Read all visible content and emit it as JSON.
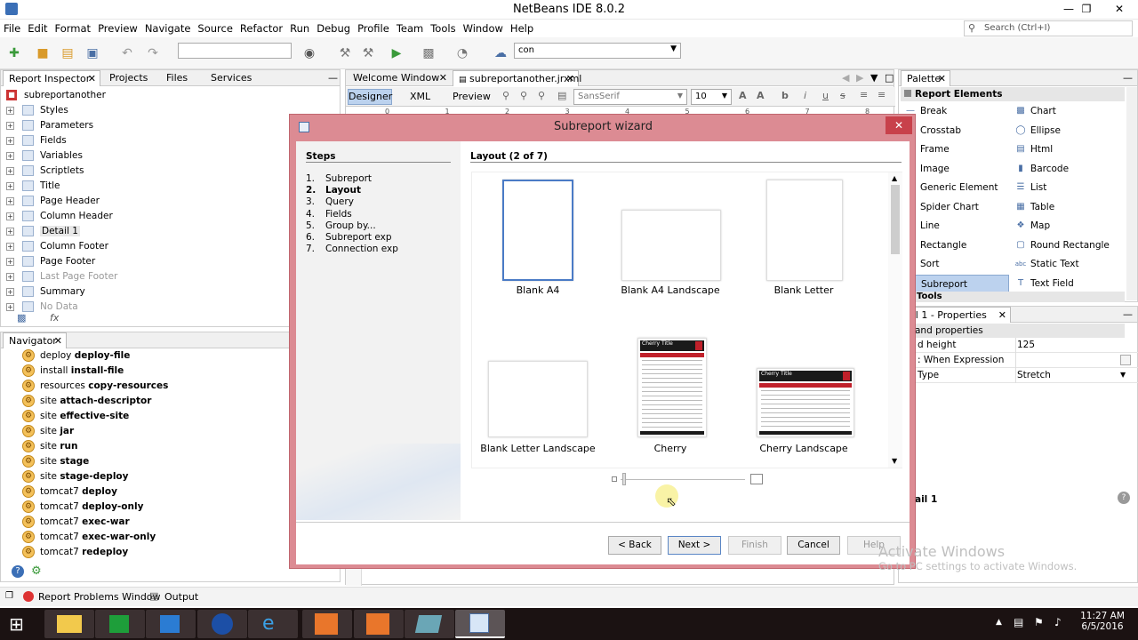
{
  "window": {
    "title": "NetBeans IDE 8.0.2"
  },
  "menu": [
    "File",
    "Edit",
    "Format",
    "Preview",
    "Navigate",
    "Source",
    "Refactor",
    "Run",
    "Debug",
    "Profile",
    "Team",
    "Tools",
    "Window",
    "Help"
  ],
  "search": {
    "placeholder": "Search (Ctrl+I)"
  },
  "toolbar": {
    "config_combo": "con"
  },
  "left_tabs": [
    "Report Inspector",
    "Projects",
    "Files",
    "Services"
  ],
  "report_tree": {
    "root": "subreportanother",
    "items": [
      {
        "label": "Styles",
        "greyed": false
      },
      {
        "label": "Parameters",
        "greyed": false
      },
      {
        "label": "Fields",
        "greyed": false
      },
      {
        "label": "Variables",
        "greyed": false
      },
      {
        "label": "Scriptlets",
        "greyed": false
      },
      {
        "label": "Title",
        "greyed": false
      },
      {
        "label": "Page Header",
        "greyed": false
      },
      {
        "label": "Column Header",
        "greyed": false
      },
      {
        "label": "Detail 1",
        "greyed": false
      },
      {
        "label": "Column Footer",
        "greyed": false
      },
      {
        "label": "Page Footer",
        "greyed": false
      },
      {
        "label": "Last Page Footer",
        "greyed": true
      },
      {
        "label": "Summary",
        "greyed": false
      },
      {
        "label": "No Data",
        "greyed": true
      }
    ]
  },
  "navigator": {
    "title": "Navigator",
    "items": [
      {
        "a": "deploy",
        "b": "deploy-file"
      },
      {
        "a": "install",
        "b": "install-file"
      },
      {
        "a": "resources",
        "b": "copy-resources"
      },
      {
        "a": "site",
        "b": "attach-descriptor"
      },
      {
        "a": "site",
        "b": "effective-site"
      },
      {
        "a": "site",
        "b": "jar"
      },
      {
        "a": "site",
        "b": "run"
      },
      {
        "a": "site",
        "b": "stage"
      },
      {
        "a": "site",
        "b": "stage-deploy"
      },
      {
        "a": "tomcat7",
        "b": "deploy"
      },
      {
        "a": "tomcat7",
        "b": "deploy-only"
      },
      {
        "a": "tomcat7",
        "b": "exec-war"
      },
      {
        "a": "tomcat7",
        "b": "exec-war-only"
      },
      {
        "a": "tomcat7",
        "b": "redeploy"
      }
    ]
  },
  "editor": {
    "tabs": [
      "Welcome Window",
      "subreportanother.jrxml"
    ],
    "subtabs": [
      "Designer",
      "XML",
      "Preview"
    ],
    "font": "SansSerif",
    "font_size": "10",
    "ruler": [
      "0",
      "1",
      "2",
      "3",
      "4",
      "5",
      "6",
      "7",
      "8"
    ]
  },
  "palette": {
    "title": "Palette",
    "section": "Report Elements",
    "left": [
      "Break",
      "Crosstab",
      "Frame",
      "Image",
      "Generic Element",
      "Spider Chart",
      "Line",
      "Rectangle",
      "Sort",
      "Subreport"
    ],
    "right": [
      "Chart",
      "Ellipse",
      "Html",
      "Barcode",
      "List",
      "Table",
      "Map",
      "Round Rectangle",
      "Static Text",
      "Text Field"
    ],
    "section2": "Tools"
  },
  "properties": {
    "title": "ail 1 - Properties",
    "section": "and properties",
    "rows": [
      {
        "k": "d height",
        "v": "125"
      },
      {
        "k": ": When Expression",
        "v": ""
      },
      {
        "k": "Type",
        "v": "Stretch"
      }
    ],
    "footer": "ail 1"
  },
  "wizard": {
    "title": "Subreport wizard",
    "steps_title": "Steps",
    "steps": [
      {
        "n": "1.",
        "label": "Subreport",
        "current": false
      },
      {
        "n": "2.",
        "label": "Layout",
        "current": true
      },
      {
        "n": "3.",
        "label": "Query",
        "current": false
      },
      {
        "n": "4.",
        "label": "Fields",
        "current": false
      },
      {
        "n": "5.",
        "label": "Group by...",
        "current": false
      },
      {
        "n": "6.",
        "label": "Subreport exp",
        "current": false
      },
      {
        "n": "7.",
        "label": "Connection exp",
        "current": false
      }
    ],
    "layout_title": "Layout (2 of 7)",
    "layouts": [
      "Blank A4",
      "Blank A4 Landscape",
      "Blank Letter",
      "Blank Letter Landscape",
      "Cherry",
      "Cherry Landscape"
    ],
    "thumb_text": "Cherry Title",
    "buttons": {
      "back": "< Back",
      "next": "Next >",
      "finish": "Finish",
      "cancel": "Cancel",
      "help": "Help"
    }
  },
  "watermark": {
    "line1": "Activate Windows",
    "line2": "Go to PC settings to activate Windows."
  },
  "statusbar": {
    "problems": "Report Problems Window",
    "output": "Output"
  },
  "clock": {
    "time": "11:27 AM",
    "date": "6/5/2016"
  }
}
